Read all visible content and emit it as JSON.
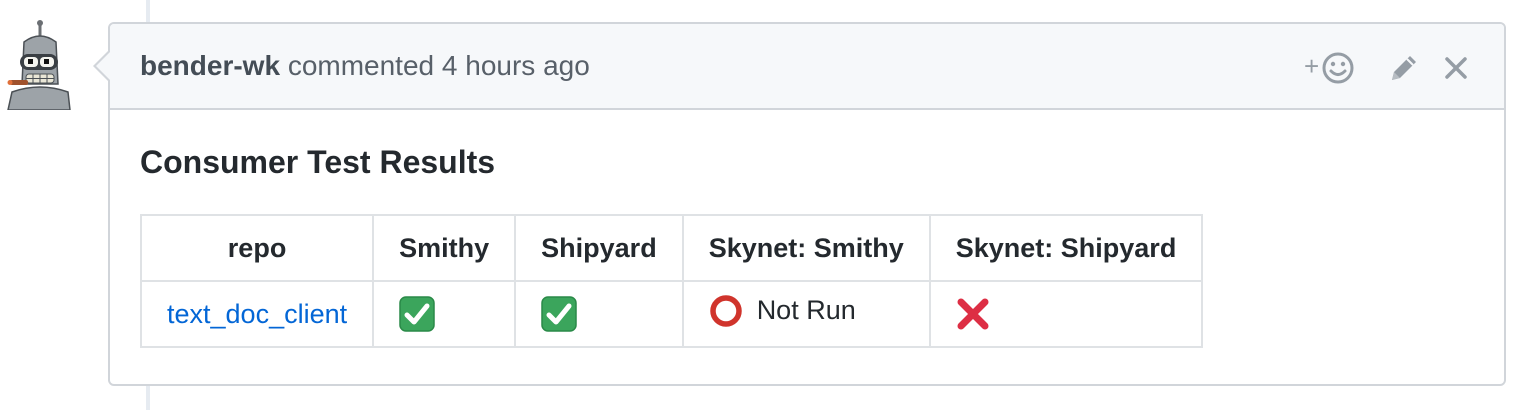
{
  "comment": {
    "author": "bender-wk",
    "action": "commented",
    "time": "4 hours ago",
    "actions": {
      "reaction_plus": "+",
      "reaction_icon": "smiley-icon",
      "edit_icon": "pencil-icon",
      "close_icon": "close-icon"
    }
  },
  "body": {
    "title": "Consumer Test Results",
    "table": {
      "headers": [
        "repo",
        "Smithy",
        "Shipyard",
        "Skynet: Smithy",
        "Skynet: Shipyard"
      ],
      "rows": [
        {
          "repo": "text_doc_client",
          "smithy": "check-mark-icon",
          "shipyard": "check-mark-icon",
          "skynet_smithy_text": "Not Run",
          "skynet_smithy_icon": "circle-icon",
          "skynet_shipyard": "cross-mark-icon"
        }
      ]
    }
  },
  "colors": {
    "link": "#0366d6",
    "check_green": "#3ba55c",
    "circle_red": "#d0342c",
    "cross_red": "#dd2e44",
    "header_bg": "#f6f8fa",
    "border": "#d1d5da"
  }
}
